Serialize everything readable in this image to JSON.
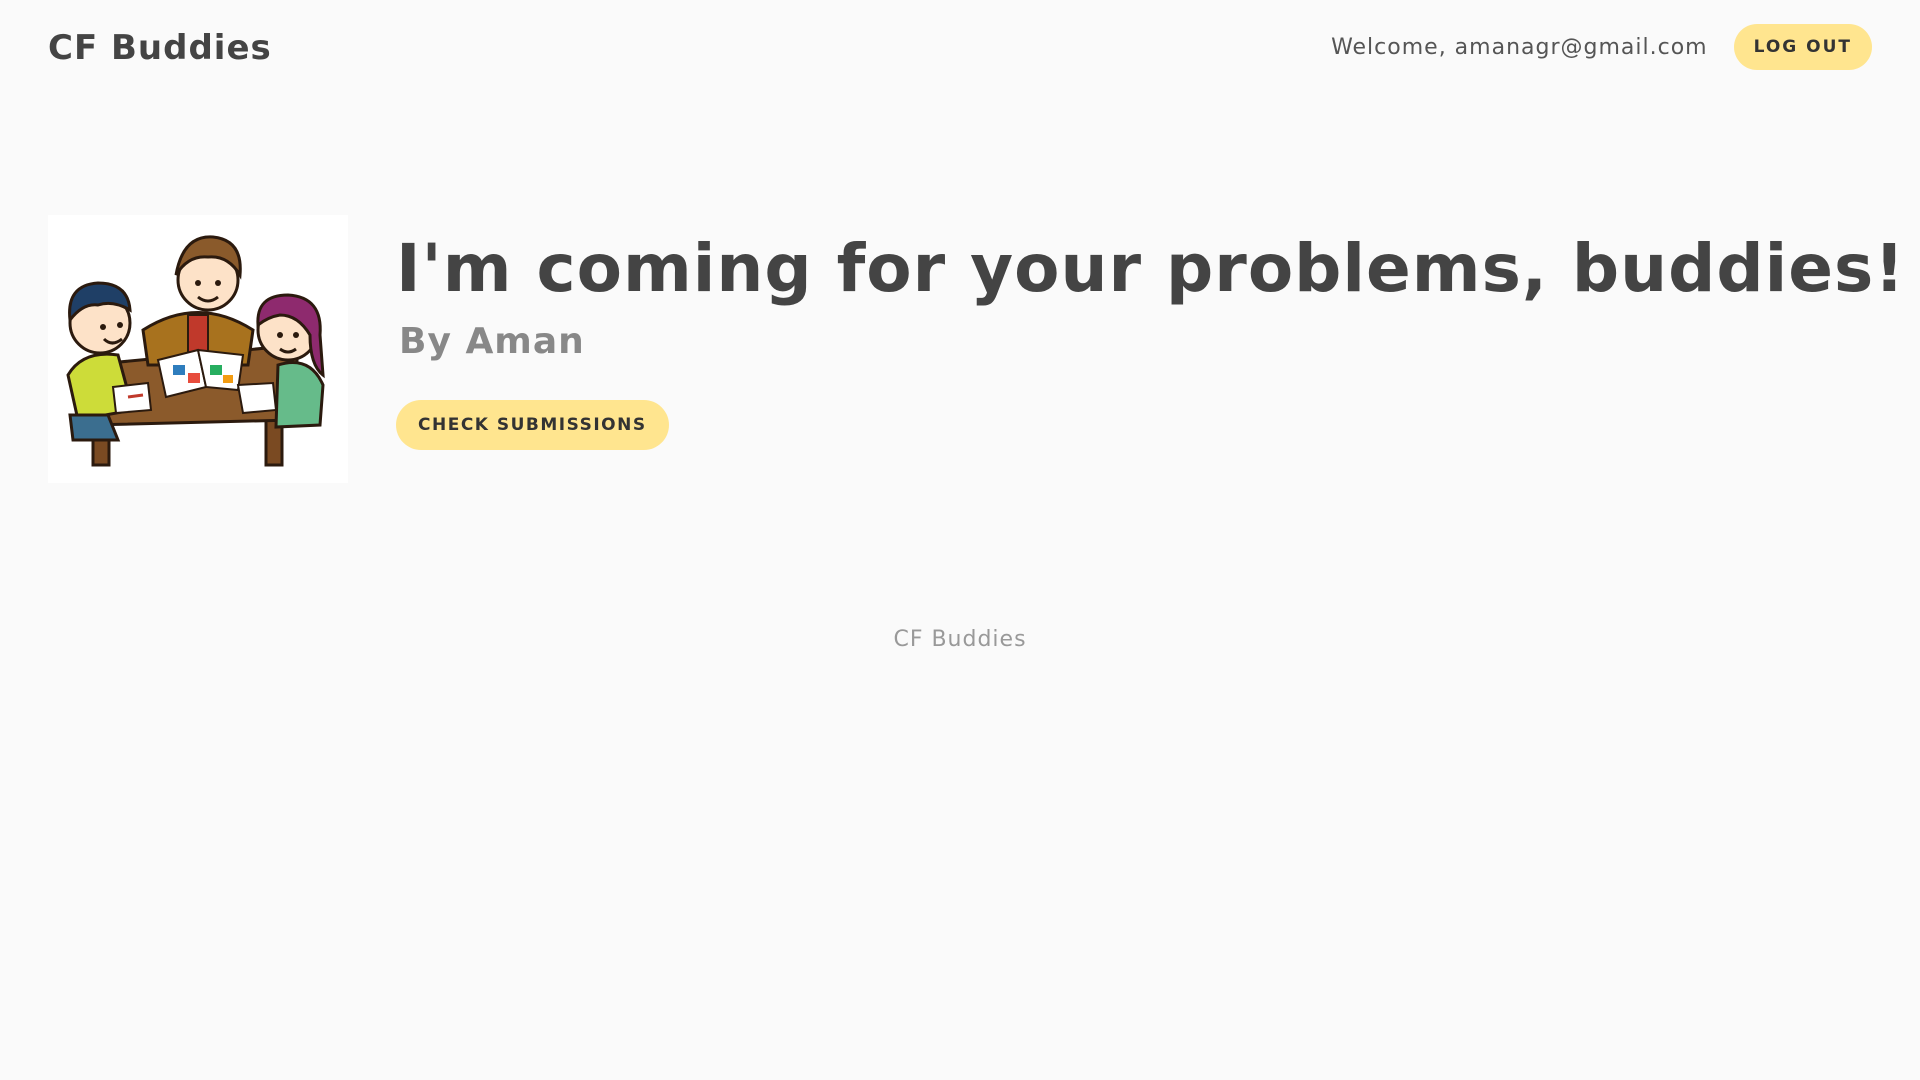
{
  "header": {
    "brand": "CF Buddies",
    "welcome_text": "Welcome, amanagr@gmail.com",
    "logout_label": "LOG OUT"
  },
  "hero": {
    "illustration_icon": "kids-reading-at-table-illustration",
    "headline": "I'm coming for your problems, buddies!",
    "byline": "By Aman",
    "cta_label": "CHECK SUBMISSIONS"
  },
  "footer": {
    "text": "CF Buddies"
  },
  "colors": {
    "background": "#fafafa",
    "accent_button": "#ffe58f",
    "text_primary": "#444444",
    "text_secondary": "#888888",
    "footer_text": "#999999"
  }
}
